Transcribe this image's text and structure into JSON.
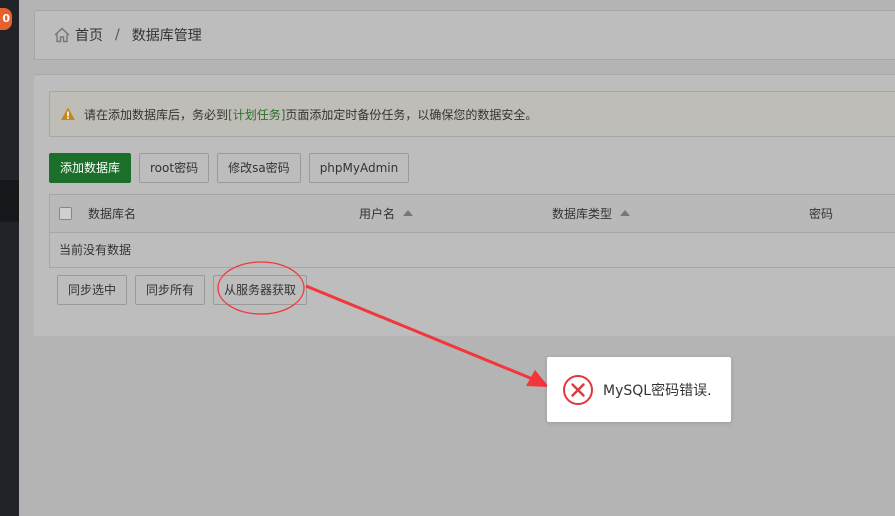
{
  "sidebar": {
    "badge": "0"
  },
  "breadcrumb": {
    "home": "首页",
    "separator": "/",
    "current": "数据库管理"
  },
  "alert": {
    "text_before": "请在添加数据库后，务必到",
    "link_text": "[计划任务]",
    "text_after": "页面添加定时备份任务，以确保您的数据安全。"
  },
  "toolbar": {
    "add_database": "添加数据库",
    "root_password": "root密码",
    "change_sa_password": "修改sa密码",
    "phpmyadmin": "phpMyAdmin"
  },
  "table": {
    "columns": [
      "数据库名",
      "用户名",
      "数据库类型",
      "密码"
    ],
    "empty_text": "当前没有数据"
  },
  "footer_buttons": {
    "sync_selected": "同步选中",
    "sync_all": "同步所有",
    "fetch_from_server": "从服务器获取"
  },
  "toast": {
    "message": "MySQL密码错误."
  },
  "colors": {
    "primary_green": "#1c6e2b",
    "annotation_red": "#f2363a",
    "badge_orange": "#e8612c"
  },
  "icons": {
    "home": "home-icon",
    "warning": "warning-icon",
    "error": "error-circle-x-icon"
  }
}
